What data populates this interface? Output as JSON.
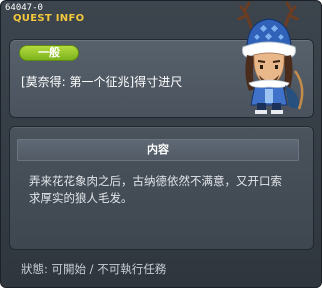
{
  "window": {
    "quest_id": "64047-0",
    "title": "QUEST INFO"
  },
  "quest": {
    "category": "一般",
    "name": "[莫奈得: 第一个征兆]得寸进尺"
  },
  "content": {
    "header": "内容",
    "lines": [
      "弄来花花象肉之后，古纳德依然不满意，又开口索",
      "求厚实的狼人毛发。"
    ]
  },
  "status": {
    "text": "狀態: 可開始 / 不可執行任務"
  },
  "icons": {
    "character": "npc-character-portrait"
  },
  "colors": {
    "title": "#f3c93b",
    "badge": "#8fc52a",
    "window_bg": "#363e47"
  }
}
